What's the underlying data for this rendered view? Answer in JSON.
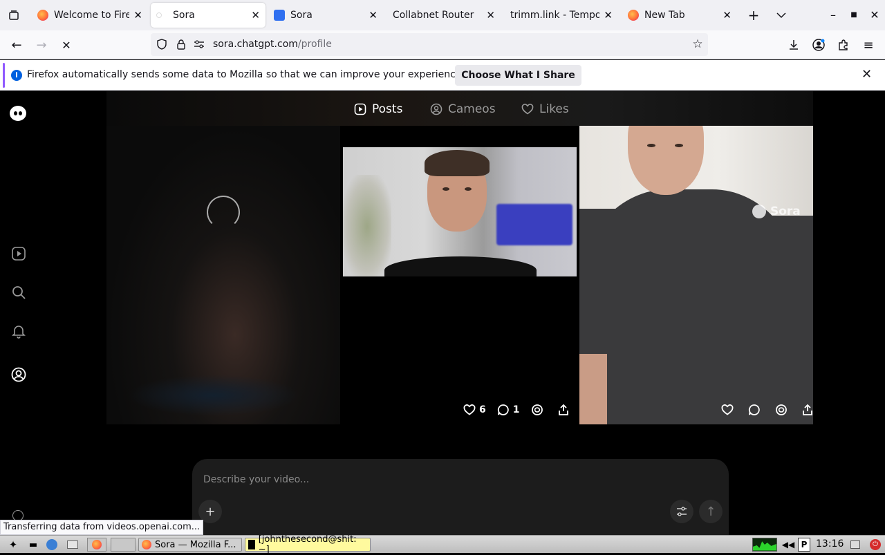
{
  "browser": {
    "tabs": [
      {
        "title": "Welcome to Firefox",
        "active": false,
        "favicon": "firefox-icon"
      },
      {
        "title": "Sora",
        "active": true,
        "favicon": "sora-icon"
      },
      {
        "title": "Sora",
        "active": false,
        "favicon": "sora-icon"
      },
      {
        "title": "Collabnet Router",
        "active": false,
        "favicon": "none"
      },
      {
        "title": "trimm.link - Temporary",
        "active": false,
        "favicon": "none"
      },
      {
        "title": "New Tab",
        "active": false,
        "favicon": "firefox-icon"
      }
    ],
    "url": {
      "host": "sora.chatgpt.com",
      "path": "/profile"
    },
    "notification": {
      "message": "Firefox automatically sends some data to Mozilla so that we can improve your experience.",
      "button_label": "Choose What I Share"
    },
    "status_tip": "Transferring data from videos.openai.com..."
  },
  "profile": {
    "tabs": [
      {
        "label": "Posts",
        "icon": "play-square-icon",
        "active": true
      },
      {
        "label": "Cameos",
        "icon": "user-circle-icon",
        "active": false
      },
      {
        "label": "Likes",
        "icon": "heart-icon",
        "active": false
      }
    ],
    "posts": [
      {
        "state": "loading"
      },
      {
        "likes": "6",
        "comments": "1"
      },
      {
        "watermark": "Sora",
        "likes": "",
        "comments": ""
      }
    ],
    "composer_placeholder": "Describe your video..."
  },
  "taskbar": {
    "tasks": [
      {
        "label": "Sora — Mozilla F..."
      },
      {
        "label": "[johnthesecond@shit: ~]"
      }
    ],
    "clock": "13:16"
  },
  "colors": {
    "accent": "#9059ff",
    "info_blue": "#0060df",
    "page_bg": "#000000"
  }
}
